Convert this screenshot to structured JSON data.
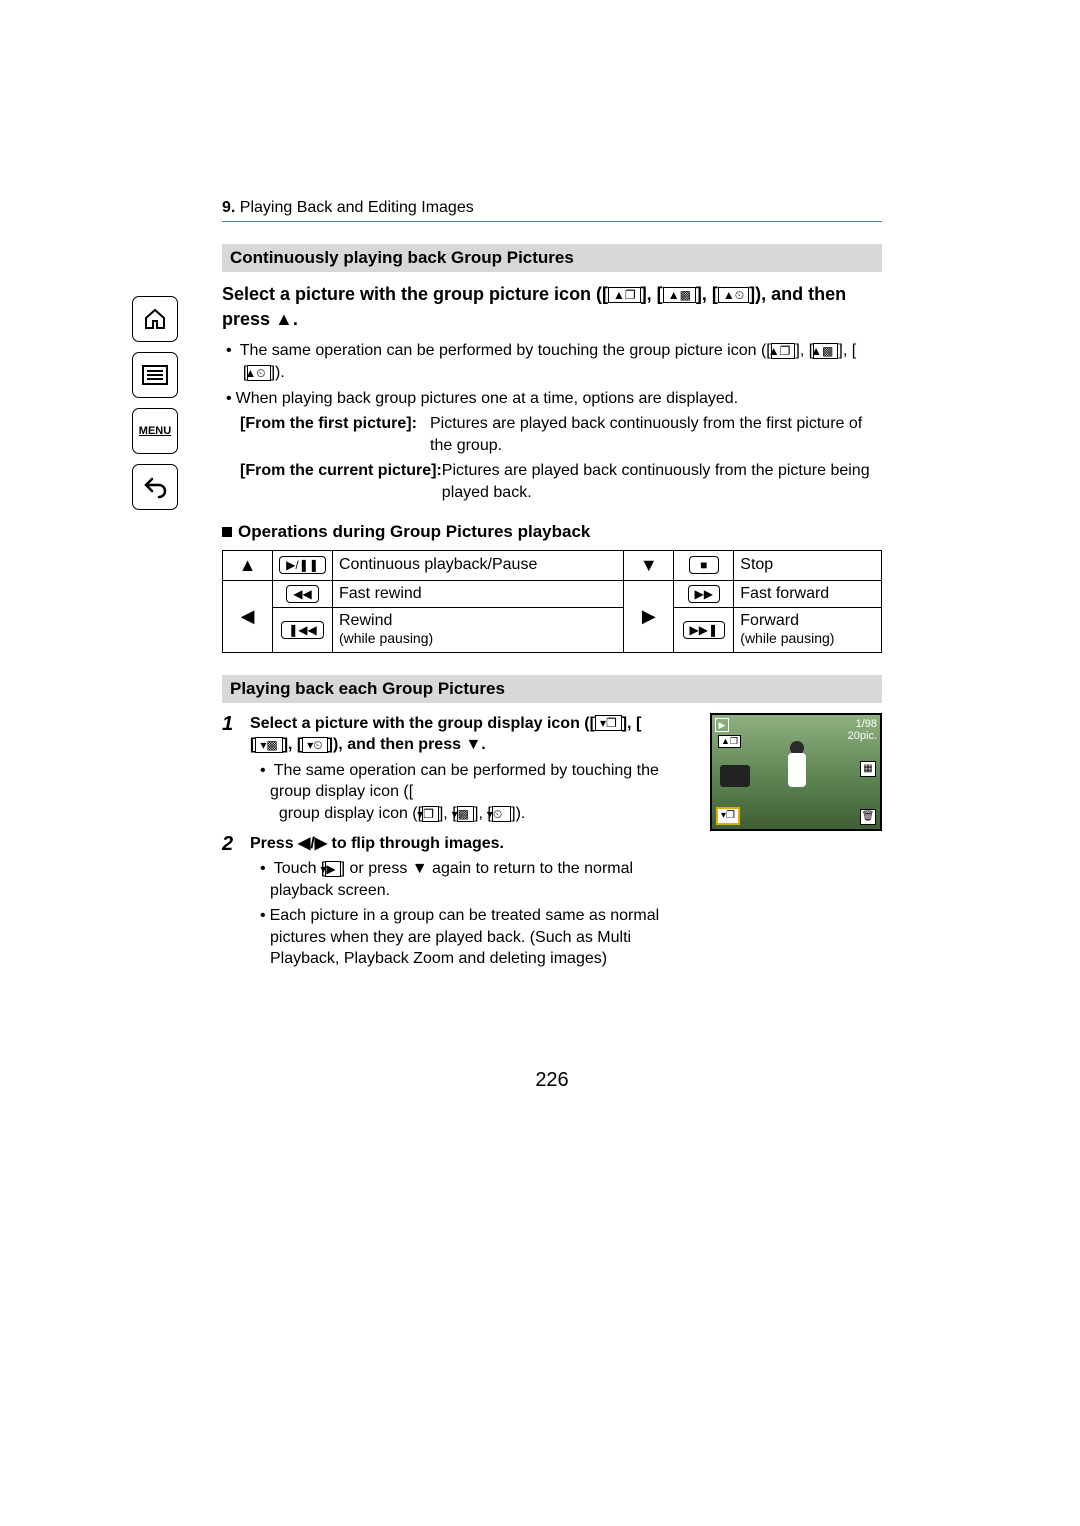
{
  "header": {
    "chapter_num": "9.",
    "chapter_title": "Playing Back and Editing Images"
  },
  "section1": {
    "title": "Continuously playing back Group Pictures",
    "instruction_pre": "Select a picture with the group picture icon ([",
    "instruction_mid1": "], [",
    "instruction_mid2": "], [",
    "instruction_post": "]), and then press ▲.",
    "note1_pre": "The same operation can be performed by touching the group picture icon ([",
    "note1_mid1": "], [",
    "note1_mid2": "], [",
    "note1_post": "]).",
    "note2": "When playing back group pictures one at a time, options are displayed.",
    "def1_label": "[From the first picture]:",
    "def1_text": "Pictures are played back continuously from the first picture of the group.",
    "def2_label": "[From the current picture]:",
    "def2_text": "Pictures are played back continuously from the picture being played back."
  },
  "ops": {
    "heading": "Operations during Group Pictures playback",
    "rows": [
      {
        "arrowL": "▲",
        "iconL": "▶/❚❚",
        "labelL": "Continuous playback/Pause",
        "arrowR": "▼",
        "iconR": "■",
        "labelR": "Stop"
      },
      {
        "arrowL": "",
        "iconL": "◀◀",
        "labelL": "Fast rewind",
        "arrowR": "",
        "iconR": "▶▶",
        "labelR": "Fast forward"
      },
      {
        "arrowL": "◀",
        "iconL": "❚◀◀",
        "labelL": "Rewind",
        "labelLsub": "(while pausing)",
        "arrowR": "▶",
        "iconR": "▶▶❚",
        "labelR": "Forward",
        "labelRsub": "(while pausing)"
      }
    ]
  },
  "section2": {
    "title": "Playing back each Group Pictures",
    "step1_num": "1",
    "step1_lead_pre": "Select a picture with the group display icon ([",
    "step1_lead_mid1": "], [",
    "step1_lead_mid2": "], [",
    "step1_lead_post": "]), and then press ▼.",
    "step1_note_pre": "The same operation can be performed by touching the group display icon ([",
    "step1_note_mid1": "], [",
    "step1_note_mid2": "], [",
    "step1_note_post": "]).",
    "step2_num": "2",
    "step2_lead": "Press ◀/▶ to flip through images.",
    "step2_note1_pre": "Touch [",
    "step2_note1_post": "] or press ▼ again to return to the normal playback screen.",
    "step2_note2": "Each picture in a group can be treated same as normal pictures when they are played back. (Such as Multi Playback, Playback Zoom and deleting images)"
  },
  "preview": {
    "count": "1/98",
    "pic_count": "20pic."
  },
  "sidebar": {
    "menu_label": "MENU"
  },
  "page_number": "226"
}
